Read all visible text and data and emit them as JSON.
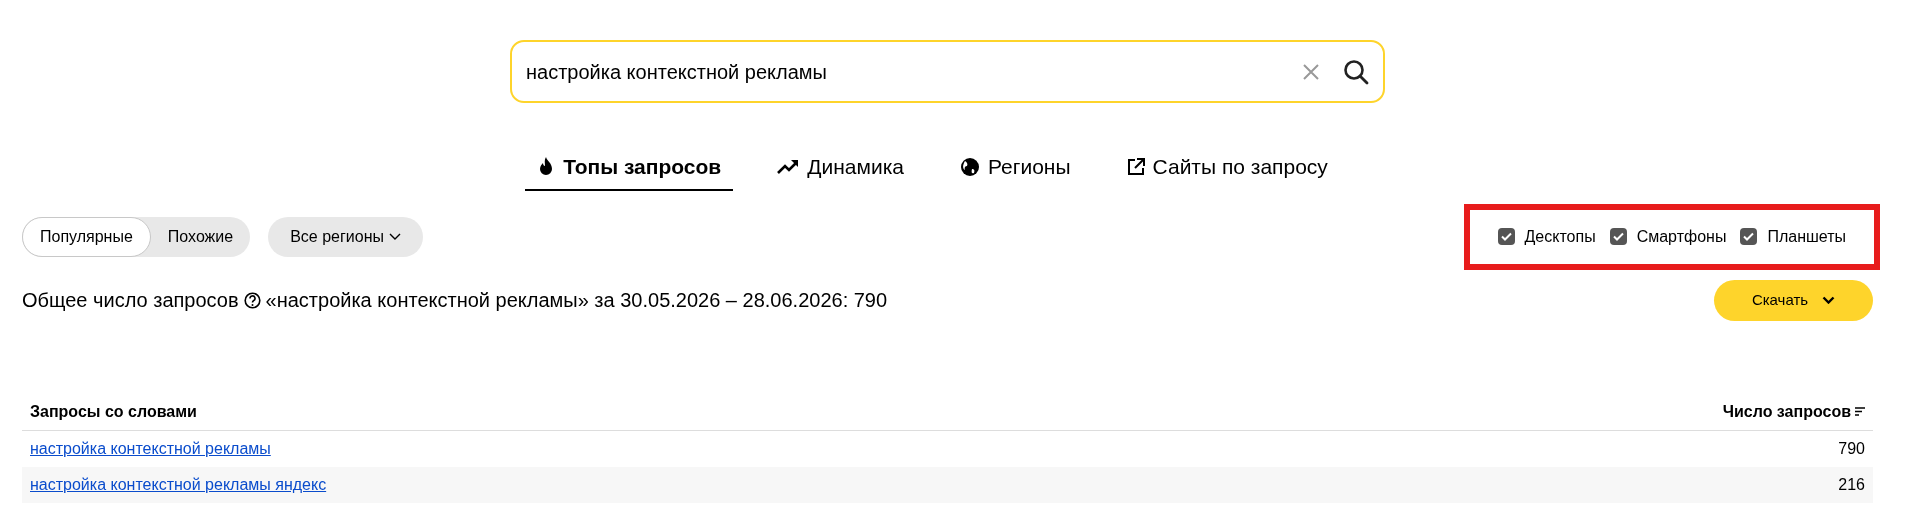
{
  "search": {
    "value": "настройка контекстной рекламы"
  },
  "tabs": [
    {
      "label": "Топы запросов",
      "kind": "fire",
      "selected": true
    },
    {
      "label": "Динамика",
      "kind": "trend",
      "selected": false
    },
    {
      "label": "Регионы",
      "kind": "globe",
      "selected": false
    },
    {
      "label": "Сайты по запросу",
      "kind": "external",
      "selected": false
    }
  ],
  "mode": [
    {
      "label": "Популярные",
      "selected": true
    },
    {
      "label": "Похожие",
      "selected": false
    }
  ],
  "region_filter": {
    "label": "Все регионы"
  },
  "devices": {
    "highlighted": true,
    "items": [
      {
        "label": "Десктопы",
        "checked": true
      },
      {
        "label": "Смартфоны",
        "checked": true
      },
      {
        "label": "Планшеты",
        "checked": true
      }
    ]
  },
  "summary": "Общее число запросов",
  "summary_rest": "«настройка контекстной рекламы» за 30.05.2026 – 28.06.2026: 790",
  "download": {
    "label": "Скачать"
  },
  "table": {
    "columns": [
      "Запросы со словами",
      "Число запросов"
    ],
    "rows": [
      {
        "query": "настройка контекстной рекламы",
        "count": "790"
      },
      {
        "query": "настройка контекстной рекламы яндекс",
        "count": "216"
      }
    ]
  }
}
